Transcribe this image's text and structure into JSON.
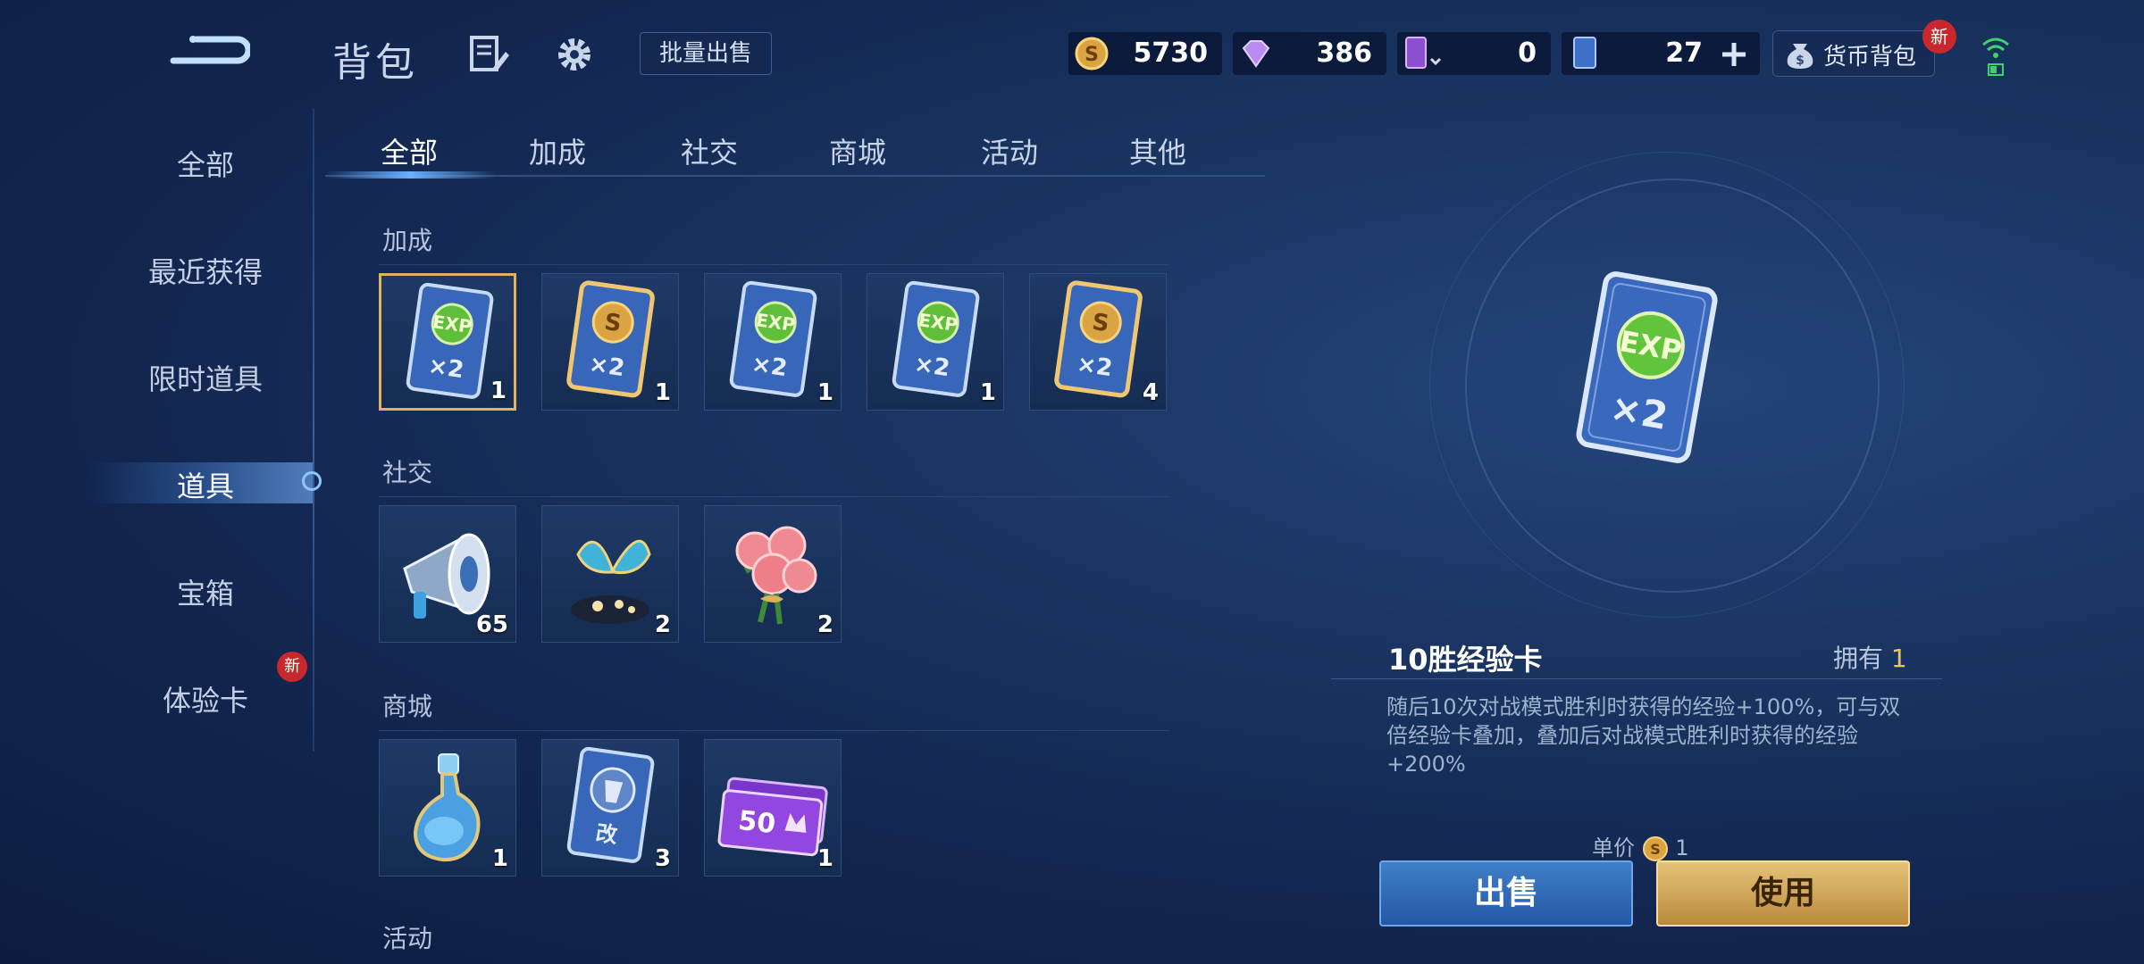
{
  "header": {
    "title": "背包",
    "batch_sell_label": "批量出售",
    "wallet_label": "货币背包",
    "new_badge": "新"
  },
  "currencies": {
    "gold": "5730",
    "diamond": "386",
    "ticket": "0",
    "card": "27"
  },
  "sidebar": {
    "items": [
      {
        "label": "全部"
      },
      {
        "label": "最近获得"
      },
      {
        "label": "限时道具"
      },
      {
        "label": "道具"
      },
      {
        "label": "宝箱"
      },
      {
        "label": "体验卡"
      }
    ],
    "new_badge": "新"
  },
  "tabs": [
    {
      "label": "全部"
    },
    {
      "label": "加成"
    },
    {
      "label": "社交"
    },
    {
      "label": "商城"
    },
    {
      "label": "活动"
    },
    {
      "label": "其他"
    }
  ],
  "sections": {
    "bonus": {
      "label": "加成",
      "counts": [
        "1",
        "1",
        "1",
        "1",
        "4"
      ]
    },
    "social": {
      "label": "社交",
      "counts": [
        "65",
        "2",
        "2"
      ]
    },
    "mall": {
      "label": "商城",
      "counts": [
        "1",
        "3",
        "1"
      ]
    },
    "activity": {
      "label": "活动"
    }
  },
  "icon_text": {
    "exp": "EXP",
    "multiplier": "×2",
    "mod": "改",
    "fifty": "50"
  },
  "detail": {
    "name": "10胜经验卡",
    "own_label": "拥有",
    "own_count": "1",
    "description": "随后10次对战模式胜利时获得的经验+100%，可与双倍经验卡叠加，叠加后对战模式胜利时获得的经验+200%",
    "price_label": "单价",
    "price": "1",
    "sell_label": "出售",
    "use_label": "使用"
  }
}
